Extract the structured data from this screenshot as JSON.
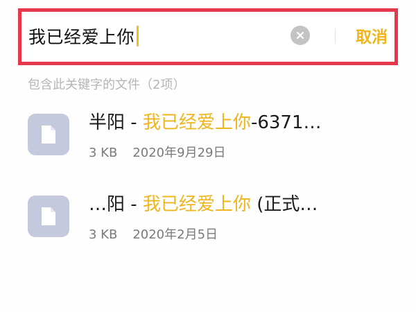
{
  "search": {
    "query": "我已经爱上你",
    "cancel_label": "取消"
  },
  "colors": {
    "highlight_border": "#e5384d",
    "accent": "#f0b51c",
    "file_icon_bg": "#c4c9de",
    "clear_button_bg": "#c3c3c6"
  },
  "results": {
    "summary": "包含此关键字的文件（2项）",
    "files": [
      {
        "name_prefix": "半阳 - ",
        "name_match": "我已经爱上你",
        "name_suffix": "-6371…",
        "size": "3 KB",
        "date": "2020年9月29日",
        "icon": "document-icon"
      },
      {
        "name_prefix": "…阳 - ",
        "name_match": "我已经爱上你",
        "name_suffix": " (正式…",
        "size": "3 KB",
        "date": "2020年2月5日",
        "icon": "document-icon"
      }
    ]
  }
}
